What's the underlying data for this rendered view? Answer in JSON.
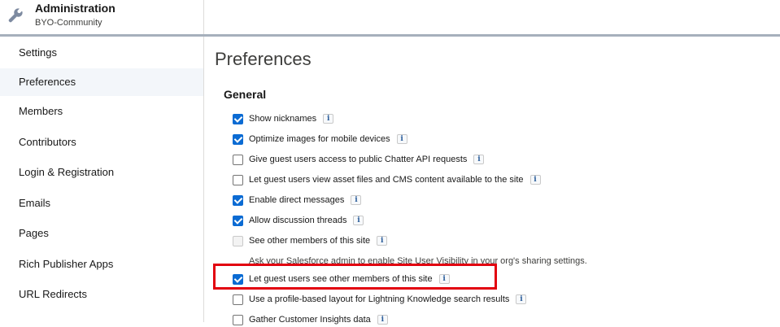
{
  "header": {
    "title": "Administration",
    "subtitle": "BYO-Community",
    "icon": "wrench-icon"
  },
  "sidebar": {
    "items": [
      {
        "label": "Settings",
        "active": false
      },
      {
        "label": "Preferences",
        "active": true
      },
      {
        "label": "Members",
        "active": false
      },
      {
        "label": "Contributors",
        "active": false
      },
      {
        "label": "Login & Registration",
        "active": false
      },
      {
        "label": "Emails",
        "active": false
      },
      {
        "label": "Pages",
        "active": false
      },
      {
        "label": "Rich Publisher Apps",
        "active": false
      },
      {
        "label": "URL Redirects",
        "active": false
      }
    ]
  },
  "main": {
    "title": "Preferences",
    "section_title": "General",
    "preferences": [
      {
        "label": "Show nicknames",
        "checked": true,
        "disabled": false
      },
      {
        "label": "Optimize images for mobile devices",
        "checked": true,
        "disabled": false
      },
      {
        "label": "Give guest users access to public Chatter API requests",
        "checked": false,
        "disabled": false
      },
      {
        "label": "Let guest users view asset files and CMS content available to the site",
        "checked": false,
        "disabled": false
      },
      {
        "label": "Enable direct messages",
        "checked": true,
        "disabled": false
      },
      {
        "label": "Allow discussion threads",
        "checked": true,
        "disabled": false
      },
      {
        "label": "See other members of this site",
        "checked": false,
        "disabled": true
      },
      {
        "label": "Let guest users see other members of this site",
        "checked": true,
        "disabled": false
      },
      {
        "label": "Use a profile-based layout for Lightning Knowledge search results",
        "checked": false,
        "disabled": false
      },
      {
        "label": "Gather Customer Insights data",
        "checked": false,
        "disabled": false
      }
    ],
    "visibility_hint": "Ask your Salesforce admin to enable Site User Visibility in your org's sharing settings.",
    "info_glyph": "i"
  },
  "colors": {
    "checkbox_checked": "#0b6bd3",
    "highlight": "#e2000f",
    "header_border": "#a6b0bc",
    "active_nav_bg": "#f3f6fa"
  }
}
